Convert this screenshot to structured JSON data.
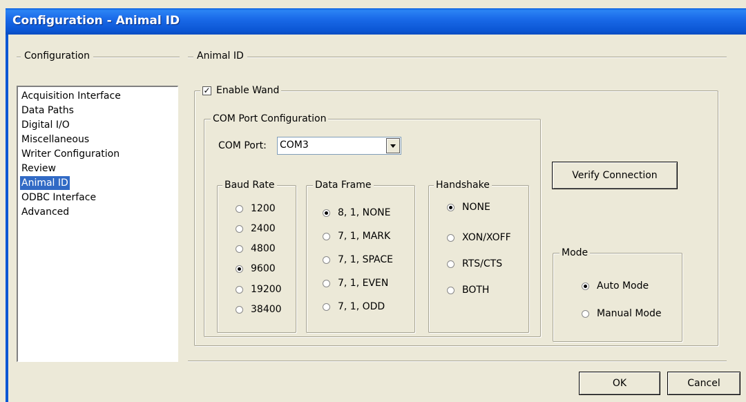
{
  "window": {
    "title": "Configuration - Animal ID"
  },
  "sections": {
    "left": "Configuration",
    "right": "Animal ID"
  },
  "nav": {
    "items": [
      "Acquisition Interface",
      "Data Paths",
      "Digital I/O",
      "Miscellaneous",
      "Writer Configuration",
      "Review",
      "Animal ID",
      "ODBC Interface",
      "Advanced"
    ],
    "selected": "Animal ID"
  },
  "wand": {
    "label": "Enable Wand",
    "checked": true
  },
  "com": {
    "group_label": "COM Port Configuration",
    "port_label": "COM Port:",
    "port_value": "COM3"
  },
  "baud": {
    "label": "Baud Rate",
    "options": [
      "1200",
      "2400",
      "4800",
      "9600",
      "19200",
      "38400"
    ],
    "selected": "9600"
  },
  "frame": {
    "label": "Data Frame",
    "options": [
      "8, 1, NONE",
      "7, 1, MARK",
      "7, 1, SPACE",
      "7, 1, EVEN",
      "7, 1, ODD"
    ],
    "selected": "8, 1, NONE"
  },
  "handshake": {
    "label": "Handshake",
    "options": [
      "NONE",
      "XON/XOFF",
      "RTS/CTS",
      "BOTH"
    ],
    "selected": "NONE"
  },
  "verify": {
    "label": "Verify Connection"
  },
  "mode": {
    "label": "Mode",
    "options": [
      "Auto Mode",
      "Manual Mode"
    ],
    "selected": "Auto Mode"
  },
  "buttons": {
    "ok": "OK",
    "cancel": "Cancel"
  },
  "colors": {
    "title_bar": "#0b56d4",
    "selection": "#316ac5",
    "face": "#ece9d8"
  }
}
